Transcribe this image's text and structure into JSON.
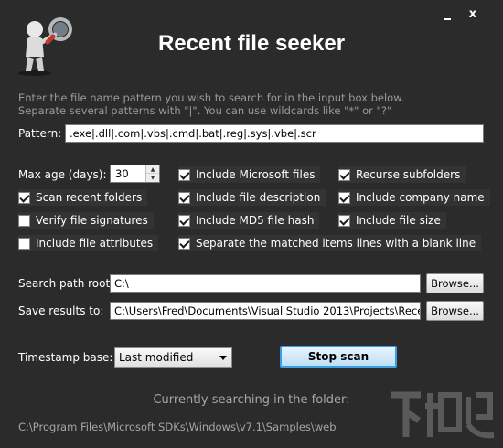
{
  "window": {
    "title": "Recent file seeker",
    "minimize_glyph": "",
    "close_glyph": "x"
  },
  "description": "Enter the file name pattern you wish to search for in the input box below.\nSeparate several patterns with \"|\". You can use wildcards like \"*\" or \"?\"",
  "pattern": {
    "label": "Pattern:",
    "value": ".exe|.dll|.com|.vbs|.cmd|.bat|.reg|.sys|.vbe|.scr"
  },
  "max_age": {
    "label": "Max age (days):",
    "value": "30"
  },
  "checkboxes": {
    "scan_recent_folders": {
      "label": "Scan recent folders",
      "checked": true
    },
    "verify_file_signatures": {
      "label": "Verify file signatures",
      "checked": false
    },
    "include_file_attributes": {
      "label": "Include file attributes",
      "checked": false
    },
    "include_microsoft_files": {
      "label": "Include Microsoft files",
      "checked": true
    },
    "include_file_description": {
      "label": "Include file description",
      "checked": true
    },
    "include_md5_file_hash": {
      "label": "Include MD5 file hash",
      "checked": true
    },
    "separate_matched_items": {
      "label": "Separate the matched items lines with a blank line",
      "checked": true
    },
    "recurse_subfolders": {
      "label": "Recurse subfolders",
      "checked": true
    },
    "include_company_name": {
      "label": "Include company name",
      "checked": true
    },
    "include_file_size": {
      "label": "Include file size",
      "checked": true
    }
  },
  "search_path": {
    "label": "Search path root:",
    "value": "C:\\",
    "browse_label": "Browse..."
  },
  "save_results": {
    "label": "Save results to:",
    "value": "C:\\Users\\Fred\\Documents\\Visual Studio 2013\\Projects\\Recen",
    "browse_label": "Browse..."
  },
  "timestamp": {
    "label": "Timestamp base:",
    "selected": "Last modified"
  },
  "stop_button_label": "Stop scan",
  "status": {
    "heading": "Currently searching in the folder:",
    "path": "C:\\Program Files\\Microsoft SDKs\\Windows\\v7.1\\Samples\\web"
  },
  "colors": {
    "background": "#2b2b2b",
    "text": "#ffffff",
    "muted_text": "#9a9a9a",
    "accent_border": "#3c9ee5"
  }
}
